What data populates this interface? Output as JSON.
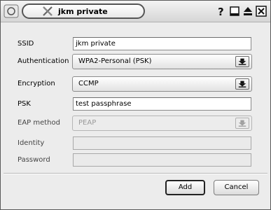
{
  "window": {
    "title": "jkm private",
    "buttons": {
      "help": "help-icon",
      "minimize": "minimize-icon",
      "maximize": "maximize-icon",
      "close": "close-icon"
    }
  },
  "form": {
    "ssid": {
      "label": "SSID",
      "value": "jkm private"
    },
    "authentication": {
      "label": "Authentication",
      "value": "WPA2-Personal (PSK)"
    },
    "encryption": {
      "label": "Encryption",
      "value": "CCMP"
    },
    "psk": {
      "label": "PSK",
      "value": "test passphrase"
    },
    "eap_method": {
      "label": "EAP method",
      "value": "PEAP",
      "enabled": false
    },
    "identity": {
      "label": "Identity",
      "value": "",
      "enabled": false
    },
    "password": {
      "label": "Password",
      "value": "",
      "enabled": false
    }
  },
  "actions": {
    "add": "Add",
    "cancel": "Cancel"
  }
}
